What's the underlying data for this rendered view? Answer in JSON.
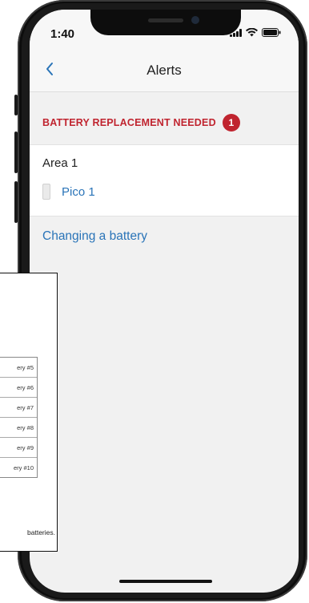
{
  "status_bar": {
    "time": "1:40"
  },
  "nav": {
    "back_icon": "chevron-left-icon",
    "title": "Alerts"
  },
  "alerts": {
    "section_title": "BATTERY REPLACEMENT NEEDED",
    "count": "1",
    "area": {
      "name": "Area 1",
      "device_icon": "pico-remote-icon",
      "device_name": "Pico 1"
    },
    "help_link": "Changing a battery"
  },
  "manual_excerpt": {
    "table_rows": [
      "ery #5",
      "ery #6",
      "ery #7",
      "ery #8",
      "ery #9",
      "ery #10"
    ],
    "footnote": "batteries."
  },
  "colors": {
    "accent_red": "#c0242f",
    "link_blue": "#2a74b8",
    "screen_background": "#f1f1f1"
  }
}
